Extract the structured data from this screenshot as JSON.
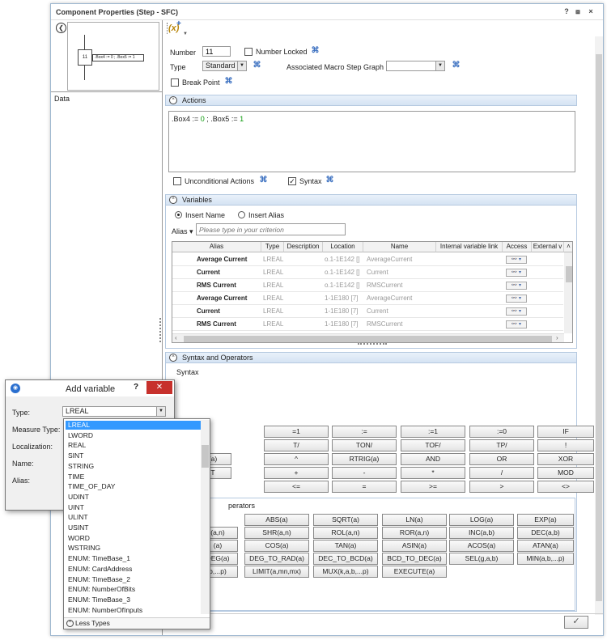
{
  "window": {
    "title": "Component Properties (Step - SFC)",
    "help_label": "?",
    "pin_label": "⧈",
    "close_label": "×"
  },
  "thumbnail": {
    "step_number": "11",
    "action_text": ".Box4 := 0 ; .Box5 := 1"
  },
  "left": {
    "data_label": "Data"
  },
  "toolbar": {
    "variable_icon": "(x)"
  },
  "form": {
    "number_label": "Number",
    "number_value": "11",
    "number_locked_label": "Number Locked",
    "type_label": "Type",
    "type_value": "Standard",
    "macro_label": "Associated Macro Step Graph",
    "macro_value": "",
    "breakpoint_label": "Break Point"
  },
  "actions": {
    "section_label": "Actions",
    "code": {
      "p1": ".Box4 := ",
      "v1": "0",
      "p2": " ; .Box5 := ",
      "v2": "1"
    },
    "unconditional_label": "Unconditional Actions",
    "syntax_label": "Syntax"
  },
  "variables": {
    "section_label": "Variables",
    "insert_name_label": "Insert Name",
    "insert_alias_label": "Insert Alias",
    "filter_label": "Alias",
    "filter_placeholder": "Please type in your criterion",
    "columns": [
      "Alias",
      "Type",
      "Description",
      "Location",
      "Name",
      "Internal variable link",
      "Access",
      "External v"
    ],
    "rows": [
      {
        "alias": "Average Current",
        "type": "LREAL",
        "desc": "",
        "loc": "o.1-1E142 []",
        "name": "AverageCurrent"
      },
      {
        "alias": "Current",
        "type": "LREAL",
        "desc": "",
        "loc": "o.1-1E142 []",
        "name": "Current"
      },
      {
        "alias": "RMS Current",
        "type": "LREAL",
        "desc": "",
        "loc": "o.1-1E142 []",
        "name": "RMSCurrent"
      },
      {
        "alias": "Average Current",
        "type": "LREAL",
        "desc": "",
        "loc": "1-1E180 [7]",
        "name": "AverageCurrent"
      },
      {
        "alias": "Current",
        "type": "LREAL",
        "desc": "",
        "loc": "1-1E180 [7]",
        "name": "Current"
      },
      {
        "alias": "RMS Current",
        "type": "LREAL",
        "desc": "",
        "loc": "1-1E180 [7]",
        "name": "RMSCurrent"
      }
    ]
  },
  "syntax": {
    "section_label": "Syntax and Operators",
    "syntax_caption": "Syntax",
    "op_rows": [
      [
        "",
        "=1",
        ":=",
        ":=1",
        ":=0",
        "IF"
      ],
      [
        "",
        "T/",
        "TON/",
        "TOF/",
        "TP/",
        "!"
      ],
      [
        "(a)",
        "^",
        "RTRIG(a)",
        "AND",
        "OR",
        "XOR"
      ],
      [
        "T",
        "+",
        "-",
        "*",
        "/",
        "MOD"
      ],
      [
        "",
        "<=",
        "=",
        ">=",
        ">",
        "<>"
      ]
    ],
    "math_caption": "perators",
    "func_rows": [
      [
        "",
        "ABS(a)",
        "SQRT(a)",
        "LN(a)",
        "LOG(a)",
        "EXP(a)"
      ],
      [
        "(a,n)",
        "SHR(a,n)",
        "ROL(a,n)",
        "ROR(a,n)",
        "INC(a,b)",
        "DEC(a,b)"
      ],
      [
        "(a)",
        "COS(a)",
        "TAN(a)",
        "ASIN(a)",
        "ACOS(a)",
        "ATAN(a)"
      ],
      [
        "DEG(a)",
        "DEG_TO_RAD(a)",
        "DEC_TO_BCD(a)",
        "BCD_TO_DEC(a)",
        "SEL(g,a,b)",
        "MIN(a,b,...p)"
      ],
      [
        "b,...p)",
        "LIMIT(a,mn,mx)",
        "MUX(k,a,b,...p)",
        "EXECUTE(a)",
        "",
        ""
      ]
    ],
    "ok_label": "✓"
  },
  "add_variable": {
    "title": "Add variable",
    "help_label": "?",
    "close_label": "✕",
    "type_label": "Type:",
    "type_value": "LREAL",
    "measure_label": "Measure Type:",
    "localization_label": "Localization:",
    "name_label": "Name:",
    "alias_label": "Alias:",
    "options": [
      "LREAL",
      "LWORD",
      "REAL",
      "SINT",
      "STRING",
      "TIME",
      "TIME_OF_DAY",
      "UDINT",
      "UINT",
      "ULINT",
      "USINT",
      "WORD",
      "WSTRING",
      "ENUM: TimeBase_1",
      "ENUM: CardAddress",
      "ENUM: TimeBase_2",
      "ENUM: NumberOfBits",
      "ENUM: TimeBase_3",
      "ENUM: NumberOfInputs"
    ],
    "less_types_label": "Less Types"
  }
}
